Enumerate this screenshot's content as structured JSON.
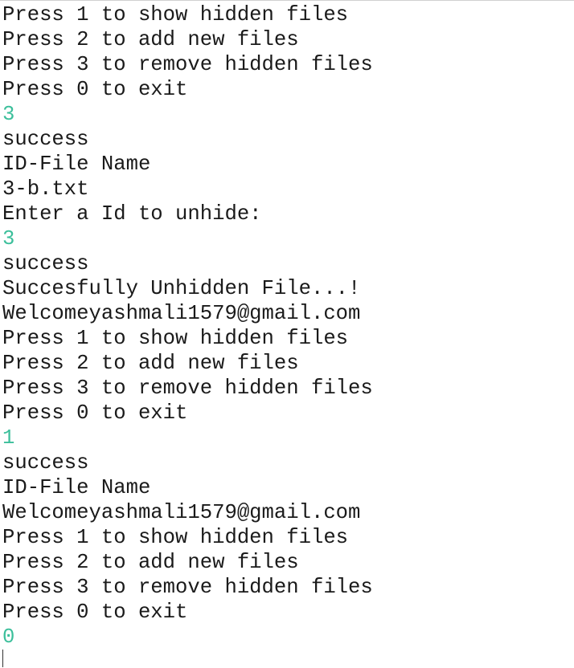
{
  "console": {
    "input_color": "#3cbf9b",
    "text_color": "#1a1a1a",
    "lines": [
      {
        "text": "Press 1 to show hidden files",
        "kind": "output"
      },
      {
        "text": "Press 2 to add new files",
        "kind": "output"
      },
      {
        "text": "Press 3 to remove hidden files",
        "kind": "output"
      },
      {
        "text": "Press 0 to exit",
        "kind": "output"
      },
      {
        "text": "3",
        "kind": "input"
      },
      {
        "text": "success",
        "kind": "output"
      },
      {
        "text": "ID-File Name",
        "kind": "output"
      },
      {
        "text": "3-b.txt",
        "kind": "output"
      },
      {
        "text": "Enter a Id to unhide:",
        "kind": "output"
      },
      {
        "text": "3",
        "kind": "input"
      },
      {
        "text": "success",
        "kind": "output"
      },
      {
        "text": "Succesfully Unhidden File...!",
        "kind": "output"
      },
      {
        "text": "Welcomeyashmali1579@gmail.com",
        "kind": "output"
      },
      {
        "text": "Press 1 to show hidden files",
        "kind": "output"
      },
      {
        "text": "Press 2 to add new files",
        "kind": "output"
      },
      {
        "text": "Press 3 to remove hidden files",
        "kind": "output"
      },
      {
        "text": "Press 0 to exit",
        "kind": "output"
      },
      {
        "text": "1",
        "kind": "input"
      },
      {
        "text": "success",
        "kind": "output"
      },
      {
        "text": "ID-File Name",
        "kind": "output"
      },
      {
        "text": "Welcomeyashmali1579@gmail.com",
        "kind": "output"
      },
      {
        "text": "Press 1 to show hidden files",
        "kind": "output"
      },
      {
        "text": "Press 2 to add new files",
        "kind": "output"
      },
      {
        "text": "Press 3 to remove hidden files",
        "kind": "output"
      },
      {
        "text": "Press 0 to exit",
        "kind": "output"
      },
      {
        "text": "0",
        "kind": "input"
      }
    ]
  }
}
